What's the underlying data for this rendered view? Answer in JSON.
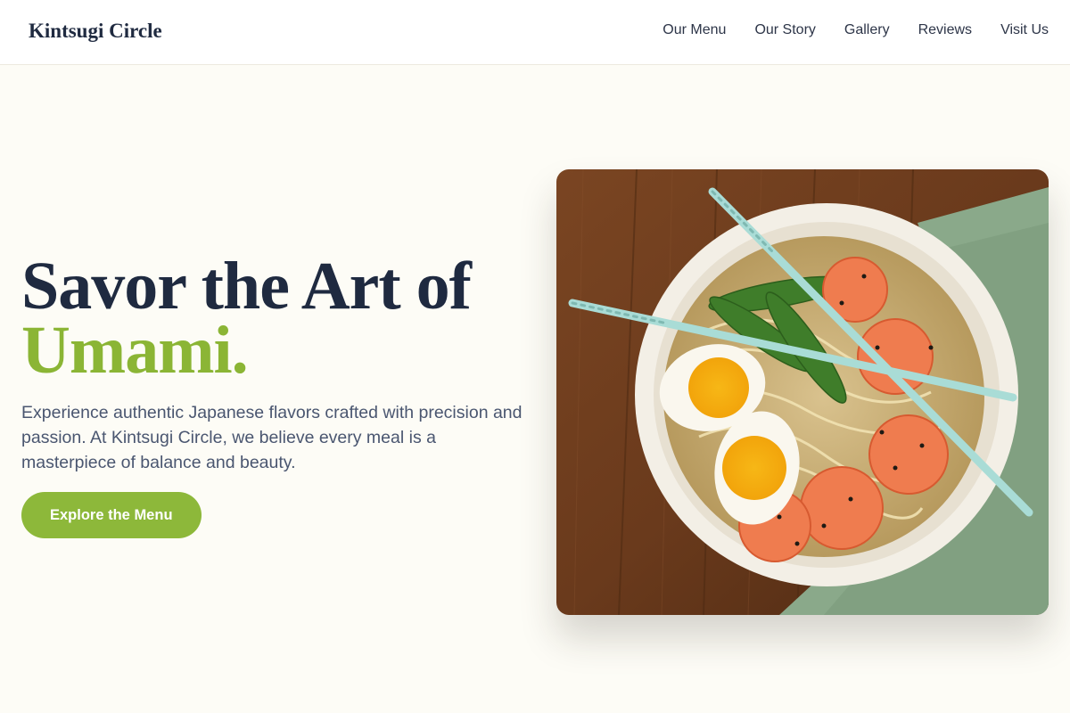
{
  "brand": {
    "name": "Kintsugi Circle"
  },
  "nav": {
    "items": [
      {
        "label": "Our Menu"
      },
      {
        "label": "Our Story"
      },
      {
        "label": "Gallery"
      },
      {
        "label": "Reviews"
      },
      {
        "label": "Visit Us"
      }
    ]
  },
  "hero": {
    "headline_line1": "Savor the Art of",
    "headline_accent": "Umami.",
    "description": "Experience authentic Japanese flavors crafted with precision and passion. At Kintsugi Circle, we believe every meal is a masterpiece of balance and beauty.",
    "cta_label": "Explore the Menu",
    "image_alt": "Bowl of ramen with soft-boiled eggs, shrimp and snow peas, with chopsticks on a wooden table"
  },
  "colors": {
    "background": "#fdfcf6",
    "heading": "#1f2a40",
    "accent": "#8db83a",
    "body_text": "#4a5670"
  }
}
